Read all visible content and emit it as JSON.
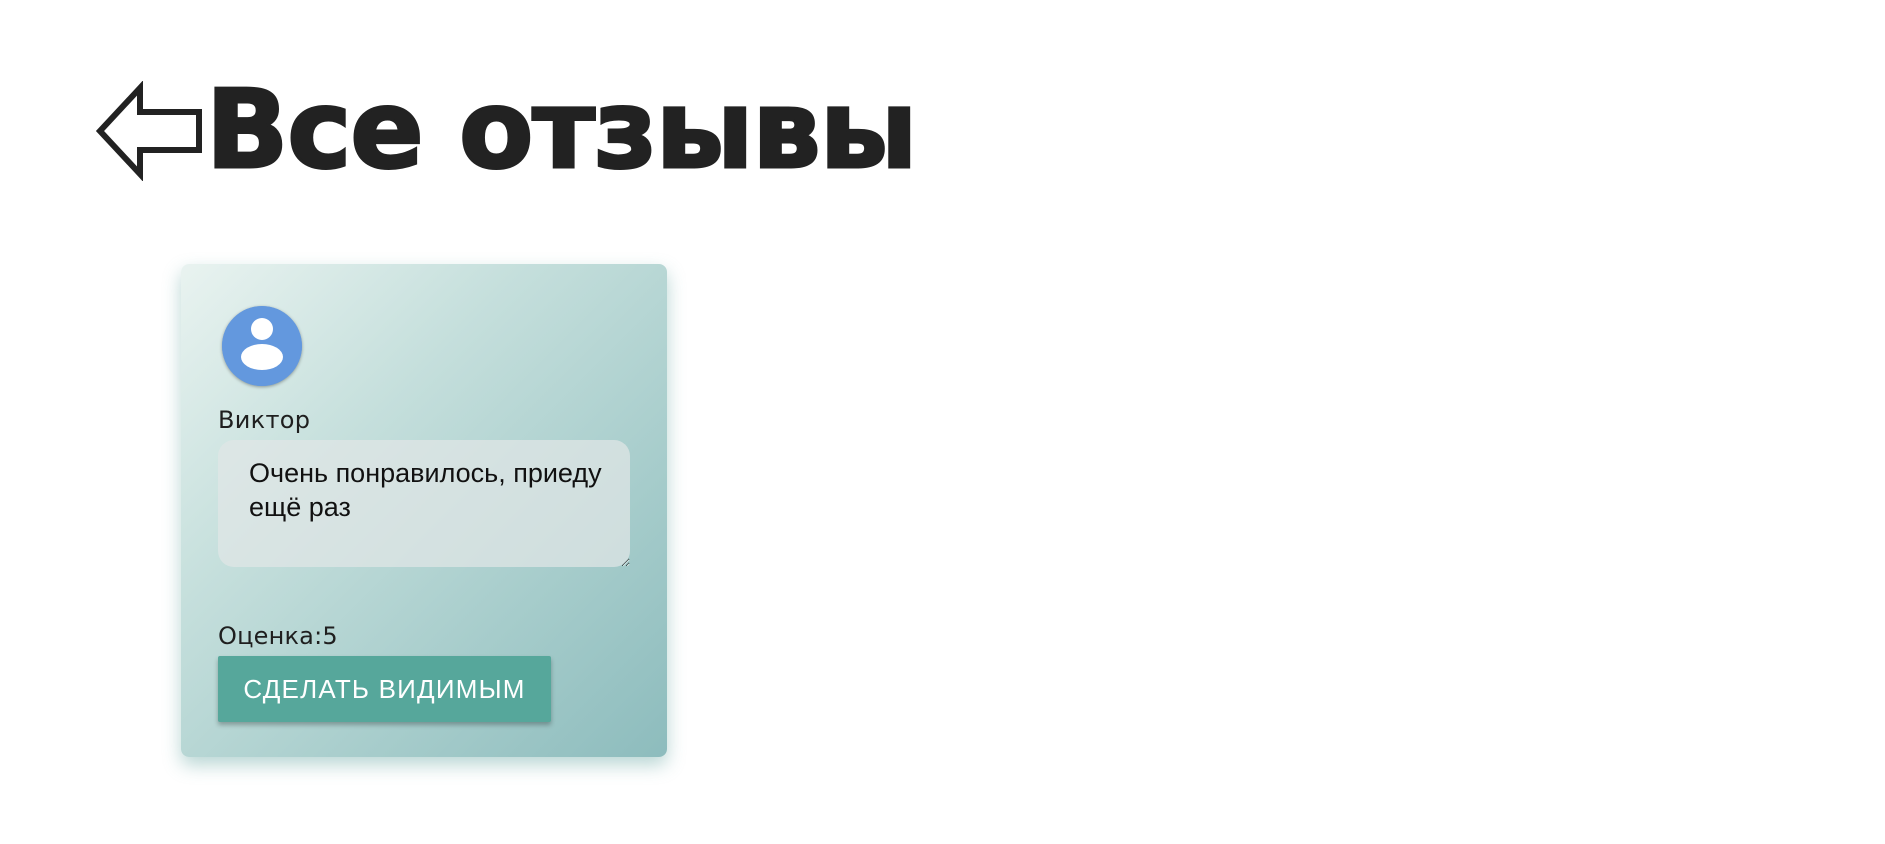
{
  "header": {
    "back_icon": "left-arrow-outline-icon",
    "title": "Все отзывы"
  },
  "reviews": [
    {
      "avatar_icon": "user-avatar-icon",
      "name": "Виктор",
      "text": "Очень понравилось, приеду ещё раз",
      "rating_label": "Оценка:5",
      "action_label": "СДЕЛАТЬ ВИДИМЫМ"
    }
  ],
  "colors": {
    "title": "#222222",
    "avatar": "#6398de",
    "button": "#56a79b",
    "button_text": "#ffffff"
  }
}
